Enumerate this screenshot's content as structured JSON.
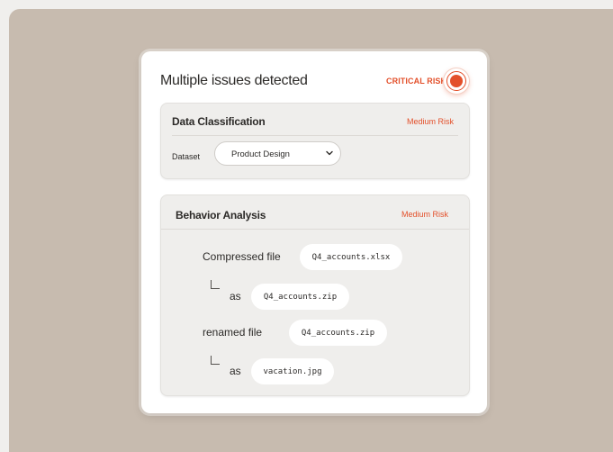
{
  "card": {
    "title": "Multiple issues detected",
    "critical_label": "CRITICAL RISK"
  },
  "data_classification": {
    "title": "Data Classification",
    "risk": "Medium Risk",
    "dataset_label": "Dataset",
    "dataset_value": "Product Design"
  },
  "behavior_analysis": {
    "title": "Behavior Analysis",
    "risk": "Medium Risk",
    "steps": [
      {
        "action": "Compressed file",
        "file": "Q4_accounts.xlsx"
      },
      {
        "action": "as",
        "file": "Q4_accounts.zip"
      },
      {
        "action": "renamed file",
        "file": "Q4_accounts.zip"
      },
      {
        "action": "as",
        "file": "vacation.jpg"
      }
    ]
  },
  "colors": {
    "accent": "#e3502b",
    "backdrop": "#c7bbaf",
    "panel": "#efeeec"
  },
  "icons": {
    "critical": "alert-dot-icon",
    "dropdown": "chevron-down-icon",
    "connector": "elbow-connector-icon"
  }
}
